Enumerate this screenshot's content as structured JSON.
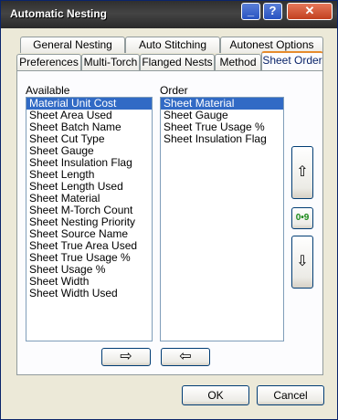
{
  "window": {
    "title": "Automatic Nesting",
    "buttons": {
      "minimize": "_",
      "help": "?",
      "close": "✕"
    }
  },
  "tabs": {
    "row_back": [
      "General Nesting",
      "Auto Stitching",
      "Autonest Options"
    ],
    "row_front": [
      "Preferences",
      "Multi-Torch",
      "Flanged Nests",
      "Method",
      "Sheet Order"
    ],
    "active": "Sheet Order"
  },
  "available": {
    "label": "Available",
    "selected_index": 0,
    "items": [
      "Material Unit Cost",
      "Sheet Area Used",
      "Sheet Batch Name",
      "Sheet Cut Type",
      "Sheet Gauge",
      "Sheet Insulation Flag",
      "Sheet Length",
      "Sheet Length Used",
      "Sheet Material",
      "Sheet M-Torch Count",
      "Sheet Nesting Priority",
      "Sheet Source Name",
      "Sheet True Area Used",
      "Sheet True Usage %",
      "Sheet Usage %",
      "Sheet Width",
      "Sheet Width Used"
    ]
  },
  "order": {
    "label": "Order",
    "selected_index": 0,
    "items": [
      "Sheet Material",
      "Sheet Gauge",
      "Sheet True Usage %",
      "Sheet Insulation Flag"
    ]
  },
  "controls": {
    "move_up": "⇧",
    "sort": "0•9",
    "move_down": "⇩",
    "add": "⇨",
    "remove": "⇦"
  },
  "dialog": {
    "ok": "OK",
    "cancel": "Cancel"
  },
  "colors": {
    "accent_tab": "#e68b2c",
    "selection": "#316ac5",
    "titlebar": "#333333"
  }
}
